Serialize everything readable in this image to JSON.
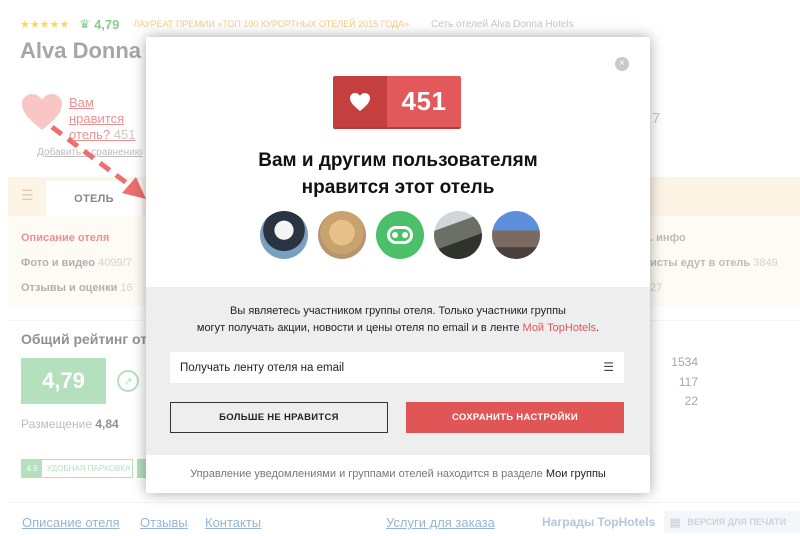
{
  "header": {
    "stars": "★★★★★",
    "rating": "4,79",
    "laureate": "ЛАУРЕАТ ПРЕМИИ «ТОП 100 КУРОРТНЫХ ОТЕЛЕЙ 2015 ГОДА»",
    "network": "Сеть отелей Alva Donna Hotels",
    "hotel_name": "Alva Donna"
  },
  "likes_block": {
    "text": "Вам нравится отель?",
    "count": "451",
    "add_compare": "Добавить к сравнению",
    "right_partial": "7"
  },
  "tabs": {
    "active": "ОТЕЛЬ",
    "partial": "В"
  },
  "info": {
    "left": [
      {
        "label": "Описание отеля",
        "count": ""
      },
      {
        "label": "Фото и видео",
        "count": "4099/7"
      },
      {
        "label": "Отзывы и оценки",
        "count": "16"
      }
    ],
    "right": [
      {
        "label": ". инфо",
        "count": ""
      },
      {
        "label": "исты едут в отель",
        "count": "3849"
      },
      {
        "label": "",
        "count": "27"
      }
    ]
  },
  "rating_panel": {
    "title": "Общий рейтинг от",
    "score": "4,79",
    "placement_label": "Размещение",
    "placement_value": "4,84",
    "right_numbers": [
      "1534",
      "117",
      "22"
    ],
    "badge_score": "4.9",
    "badge_label": "УДОБНАЯ ПАРКОВКА"
  },
  "bottom": {
    "links": [
      "Описание отеля",
      "Отзывы",
      "Контакты"
    ],
    "services": "Услуги для заказа",
    "awards": "Награды TopHotels",
    "print": "ВЕРСИЯ ДЛЯ ПЕЧАТИ"
  },
  "modal": {
    "close": "×",
    "like_count": "451",
    "title_line1": "Вам и другим пользователям",
    "title_line2": "нравится этот отель",
    "member_line1": "Вы являетесь участником группы отеля. Только участники группы",
    "member_line2": "могут получать акции, новости и цены отеля по email и в ленте",
    "member_link": "Мой TopHotels",
    "member_dot": ".",
    "select_value": "Получать ленту отеля на email",
    "dislike_button": "БОЛЬШЕ НЕ НРАВИТСЯ",
    "save_button": "СОХРАНИТЬ НАСТРОЙКИ",
    "footer_text": "Управление уведомлениями и группами отелей находится в разделе",
    "footer_link": "Мои группы"
  },
  "colors": {
    "accent_red": "#e05656",
    "dark_red": "#c63f3f",
    "green": "#8ed09a",
    "tab_bg": "#fbeed7"
  }
}
